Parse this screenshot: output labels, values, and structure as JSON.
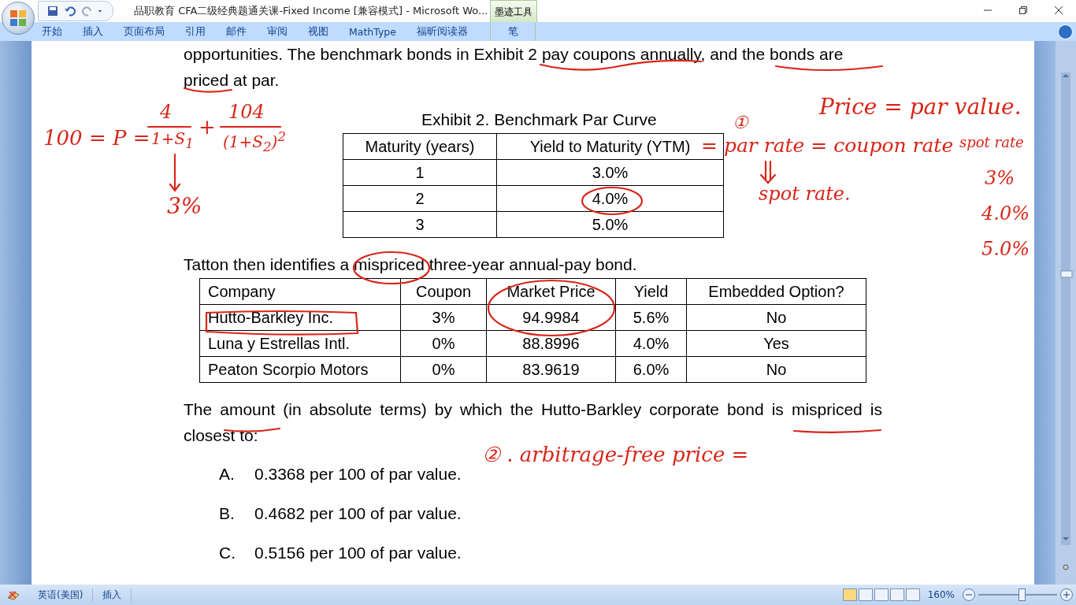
{
  "window": {
    "title": "品职教育 CFA二级经典题通关课-Fixed Income [兼容模式] - Microsoft Wo...",
    "contextual_group": "墨迹工具"
  },
  "ribbon_tabs": [
    {
      "label": "开始"
    },
    {
      "label": "插入"
    },
    {
      "label": "页面布局"
    },
    {
      "label": "引用"
    },
    {
      "label": "邮件"
    },
    {
      "label": "审阅"
    },
    {
      "label": "视图"
    },
    {
      "label": "MathType"
    },
    {
      "label": "福昕阅读器"
    },
    {
      "label": "笔",
      "kind": "contextual"
    }
  ],
  "document": {
    "intro": "opportunities. The benchmark bonds in Exhibit 2 pay coupons annually, and the bonds are priced at par.",
    "exhibit_title": "Exhibit 2. Benchmark Par Curve",
    "par_curve": {
      "columns": [
        "Maturity (years)",
        "Yield to Maturity (YTM)"
      ],
      "rows": [
        [
          "1",
          "3.0%"
        ],
        [
          "2",
          "4.0%"
        ],
        [
          "3",
          "5.0%"
        ]
      ]
    },
    "bond_intro": "Tatton then identifies a mispriced three-year annual-pay bond.",
    "bonds": {
      "columns": [
        "Company",
        "Coupon",
        "Market Price",
        "Yield",
        "Embedded Option?"
      ],
      "rows": [
        [
          "Hutto-Barkley Inc.",
          "3%",
          "94.9984",
          "5.6%",
          "No"
        ],
        [
          "Luna y Estrellas Intl.",
          "0%",
          "88.8996",
          "4.0%",
          "Yes"
        ],
        [
          "Peaton Scorpio Motors",
          "0%",
          "83.9619",
          "6.0%",
          "No"
        ]
      ]
    },
    "question": "The amount (in absolute terms) by which the Hutto-Barkley corporate bond is mispriced is closest to:",
    "options": [
      {
        "letter": "A.",
        "text": "0.3368 per 100 of par value."
      },
      {
        "letter": "B.",
        "text": "0.4682 per 100 of par value."
      },
      {
        "letter": "C.",
        "text": "0.5156 per 100 of par value."
      }
    ]
  },
  "ink_notes": [
    {
      "text": "Price = par value."
    },
    {
      "text": "①"
    },
    {
      "text": "= par rate = coupon rate"
    },
    {
      "text": "spot rate."
    },
    {
      "text": "spot rate"
    },
    {
      "text": "3%"
    },
    {
      "text": "4.0%"
    },
    {
      "text": "5.0%"
    },
    {
      "text": "100 = P ="
    },
    {
      "text": "4"
    },
    {
      "text": "1+S$_{1}$"
    },
    {
      "text": "+"
    },
    {
      "text": "104"
    },
    {
      "text": "(1+S$_{2}$)$^{2}$"
    },
    {
      "text": "3%"
    },
    {
      "text": "② . arbitrage-free price ="
    }
  ],
  "status_bar": {
    "language": "英语(美国)",
    "mode": "插入",
    "zoom": "160%",
    "zoom_slider": {
      "level": 0.55
    }
  }
}
